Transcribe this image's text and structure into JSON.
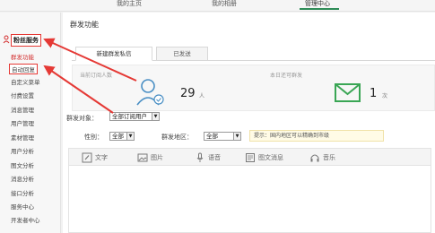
{
  "topnav": {
    "items": [
      "我的主页",
      "我的相册",
      "管理中心"
    ],
    "active_index": 2
  },
  "sidebar": {
    "section_title": "粉丝服务",
    "items": [
      {
        "label": "群发功能",
        "state": "selected"
      },
      {
        "label": "自动回复",
        "state": "highlighted"
      },
      {
        "label": "自定义菜单"
      },
      {
        "label": "付费设置"
      },
      {
        "label": "消息管理"
      },
      {
        "label": "用户管理"
      },
      {
        "label": "素材管理"
      },
      {
        "label": "用户分析"
      },
      {
        "label": "图文分析"
      },
      {
        "label": "消息分析"
      },
      {
        "label": "接口分析"
      },
      {
        "label": "服务中心"
      },
      {
        "label": "开发者中心"
      }
    ]
  },
  "main": {
    "title": "群发功能",
    "tabs": [
      "新建群发私信",
      "已发送"
    ],
    "active_tab": 0,
    "stats": {
      "subscribers_label": "当前订阅人数",
      "subscribers_value": "29",
      "subscribers_unit": "人",
      "remaining_label": "本日还可群发",
      "remaining_value": "1",
      "remaining_unit": "次"
    },
    "target_label": "群发对象：",
    "target_value": "全部订阅用户",
    "gender_label": "性别：",
    "gender_value": "全部",
    "region_label": "群发地区：",
    "region_value": "全部",
    "hint": "提示：国内地区可以精确到市级",
    "toolbar": [
      "文字",
      "图片",
      "语音",
      "图文消息",
      "音乐"
    ],
    "active_tool": 0
  },
  "colors": {
    "accent_green": "#2e8b57",
    "highlight_red": "#e53935",
    "avatar_blue": "#4a8fc4",
    "envelope_green": "#3aa655"
  }
}
